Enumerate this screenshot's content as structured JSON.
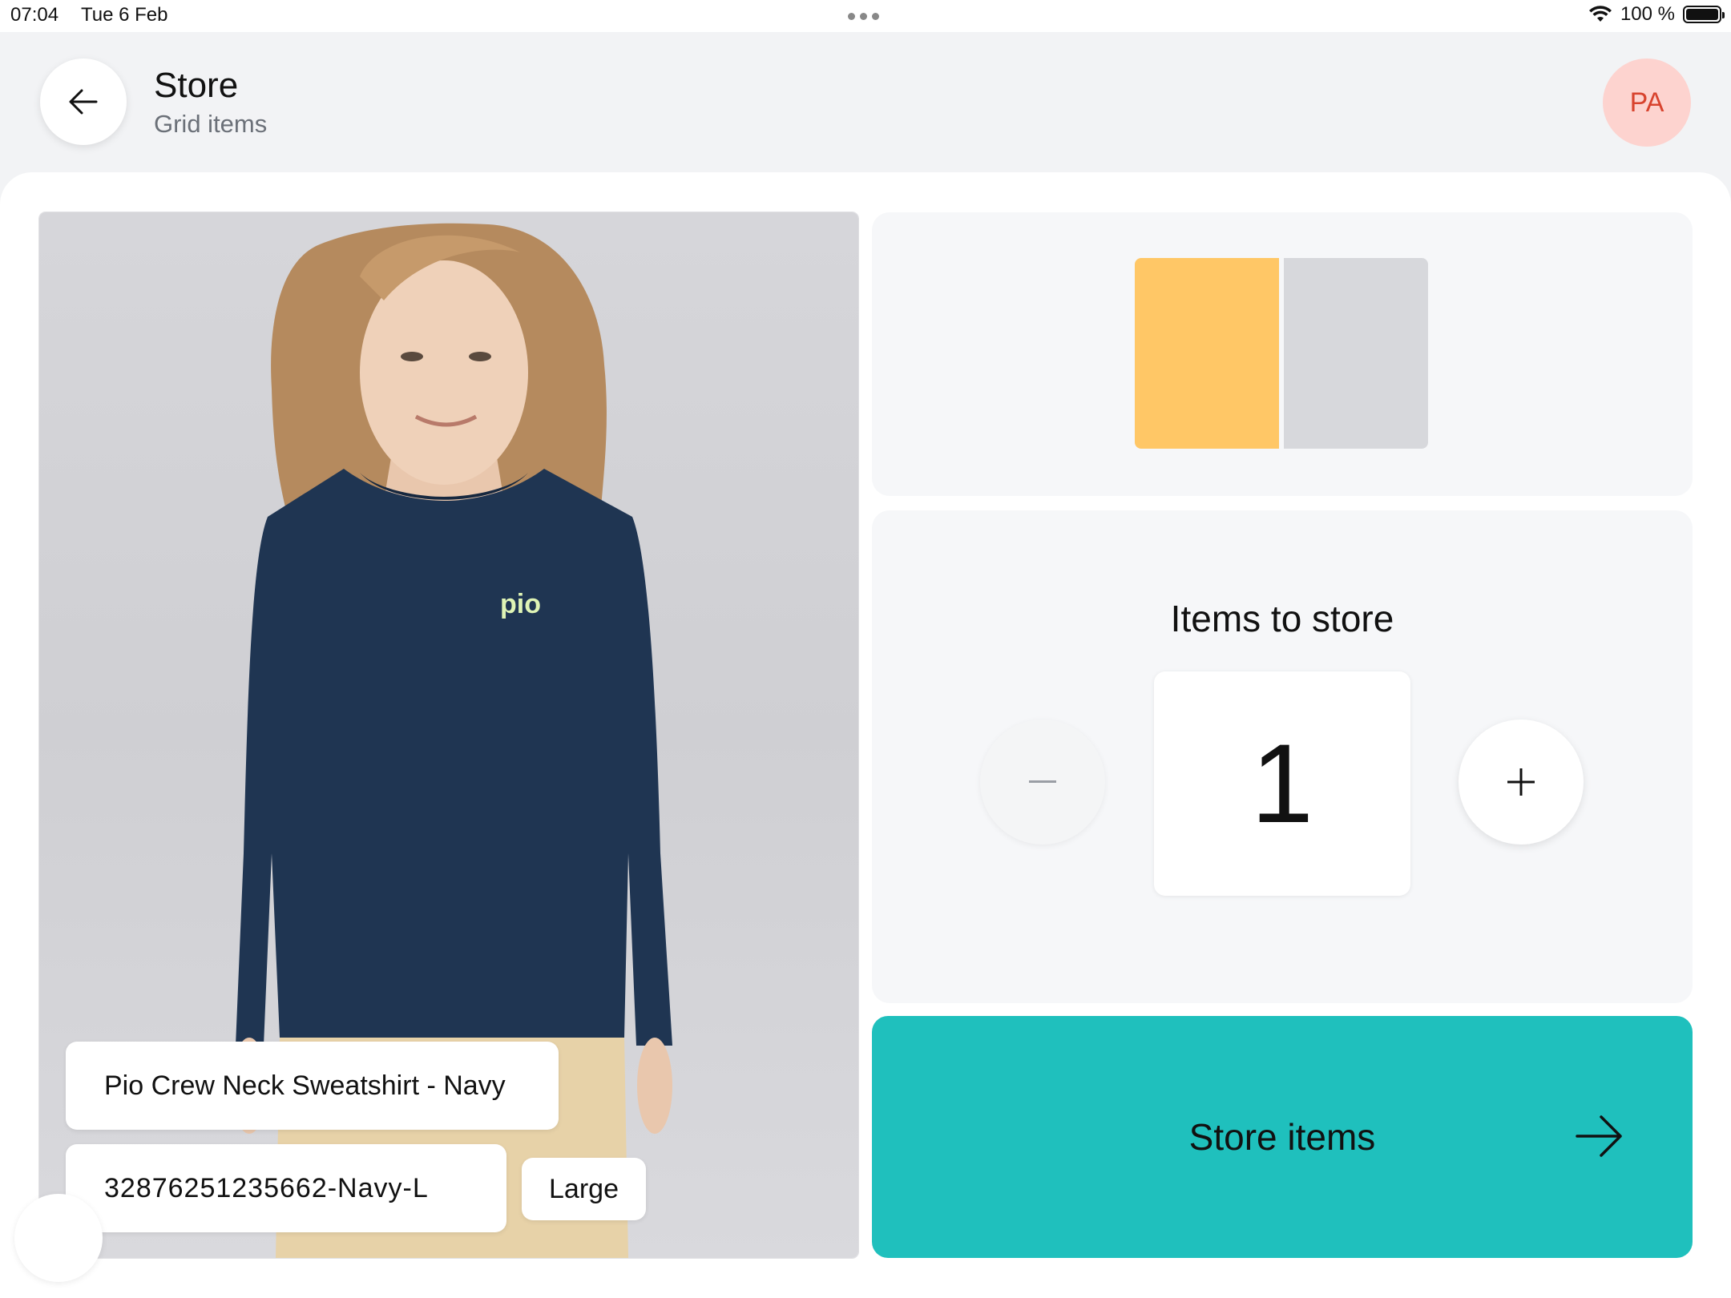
{
  "status_bar": {
    "time": "07:04",
    "date": "Tue 6 Feb",
    "battery": "100 %"
  },
  "header": {
    "title": "Store",
    "subtitle": "Grid items",
    "avatar_initials": "PA",
    "back_icon": "arrow-left-icon"
  },
  "product": {
    "name": "Pio Crew Neck Sweatshirt - Navy",
    "sku": "32876251235662-Navy-L",
    "size": "Large",
    "logo_text": "pio"
  },
  "grid": {
    "cells": [
      {
        "state": "selected",
        "color": "#ffc766"
      },
      {
        "state": "empty",
        "color": "#d7d8dc"
      }
    ]
  },
  "quantity": {
    "label": "Items to store",
    "value": "1",
    "minus_symbol": "–",
    "plus_symbol": "+"
  },
  "action": {
    "label": "Store items",
    "icon": "arrow-right-icon",
    "color": "#1fc0bd"
  }
}
